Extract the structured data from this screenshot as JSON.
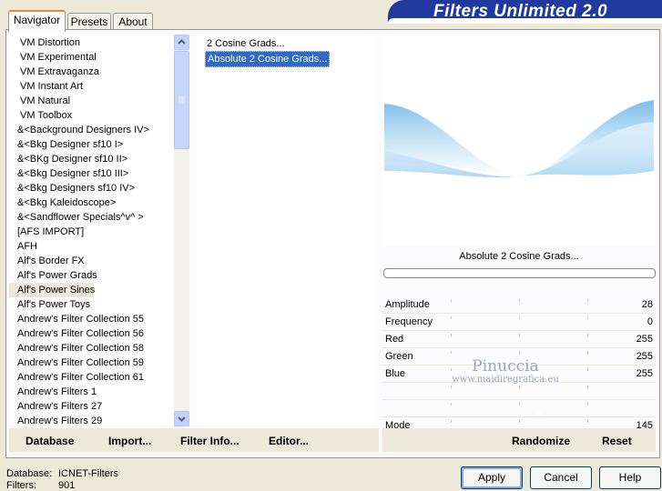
{
  "app": {
    "title": "Filters Unlimited 2.0",
    "tabs": [
      {
        "label": "Navigator",
        "active": true
      },
      {
        "label": "Presets",
        "active": false
      },
      {
        "label": "About",
        "active": false
      }
    ]
  },
  "categories": [
    "VM Distortion",
    "VM Experimental",
    "VM Extravaganza",
    "VM Instant Art",
    "VM Natural",
    "VM Toolbox",
    "&<Background Designers IV>",
    "&<Bkg Designer sf10 I>",
    "&<BKg Designer sf10 II>",
    "&<Bkg Designer sf10 III>",
    "&<Bkg Designers sf10 IV>",
    "&<Bkg Kaleidoscope>",
    "&<Sandflower Specials^v^ >",
    "[AFS IMPORT]",
    "AFH",
    "Alf's Border FX",
    "Alf's Power Grads",
    "Alf's Power Sines",
    "Alf's Power Toys",
    "Andrew's Filter Collection 55",
    "Andrew's Filter Collection 56",
    "Andrew's Filter Collection 58",
    "Andrew's Filter Collection 59",
    "Andrew's Filter Collection 61",
    "Andrew's Filters 1",
    "Andrew's Filters 27",
    "Andrew's Filters 29"
  ],
  "selected_category": "Alf's Power Sines",
  "filters": [
    "2 Cosine Grads...",
    "Absolute 2 Cosine Grads..."
  ],
  "selected_filter": "Absolute 2 Cosine Grads...",
  "preview": {
    "name": "Absolute 2 Cosine Grads...",
    "progress": 0
  },
  "params": [
    {
      "label": "Amplitude",
      "value": "28"
    },
    {
      "label": "Frequency",
      "value": "0"
    },
    {
      "label": "Red",
      "value": "255"
    },
    {
      "label": "Green",
      "value": "255"
    },
    {
      "label": "Blue",
      "value": "255"
    },
    {
      "label": "",
      "value": ""
    },
    {
      "label": "",
      "value": ""
    },
    {
      "label": "Mode",
      "value": "145"
    }
  ],
  "watermark": {
    "line1": "Pinuccia",
    "line2": "www.maidiregrafica.eu"
  },
  "toolbar": {
    "database": "Database",
    "import": "Import...",
    "filter_info": "Filter Info...",
    "editor": "Editor...",
    "randomize": "Randomize",
    "reset": "Reset"
  },
  "footer": {
    "database_label": "Database:",
    "database_value": "ICNET-Filters",
    "filters_label": "Filters:",
    "filters_value": "901",
    "apply": "Apply",
    "cancel": "Cancel",
    "help": "Help"
  },
  "colors": {
    "banner": "#1f3a9c",
    "selection": "#316ac5",
    "tab_accent": "#e68b2c"
  }
}
